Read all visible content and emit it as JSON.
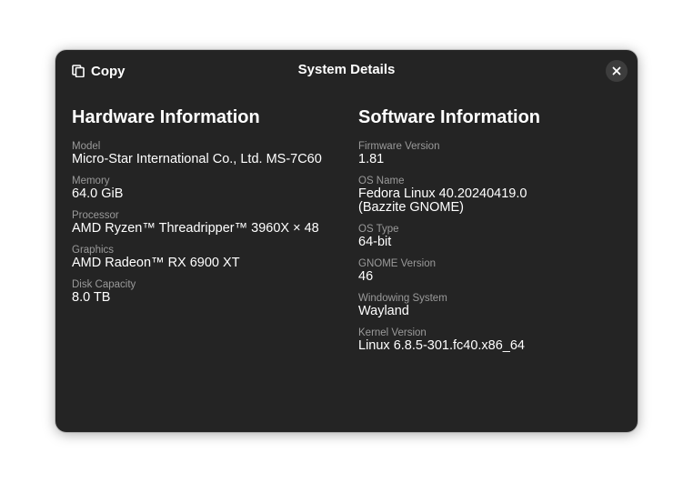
{
  "header": {
    "copy_label": "Copy",
    "title": "System Details",
    "copy_icon": "copy-icon",
    "close_icon": "close-icon"
  },
  "hardware": {
    "title": "Hardware Information",
    "fields": [
      {
        "label": "Model",
        "value": "Micro-Star International Co., Ltd. MS-7C60"
      },
      {
        "label": "Memory",
        "value": "64.0 GiB"
      },
      {
        "label": "Processor",
        "value": "AMD Ryzen™ Threadripper™ 3960X × 48"
      },
      {
        "label": "Graphics",
        "value": "AMD Radeon™ RX 6900 XT"
      },
      {
        "label": "Disk Capacity",
        "value": "8.0 TB"
      }
    ]
  },
  "software": {
    "title": "Software Information",
    "fields": [
      {
        "label": "Firmware Version",
        "value": "1.81"
      },
      {
        "label": "OS Name",
        "value": "Fedora Linux 40.20240419.0\n(Bazzite GNOME)"
      },
      {
        "label": "OS Type",
        "value": "64-bit"
      },
      {
        "label": "GNOME Version",
        "value": "46"
      },
      {
        "label": "Windowing System",
        "value": "Wayland"
      },
      {
        "label": "Kernel Version",
        "value": "Linux 6.8.5-301.fc40.x86_64"
      }
    ]
  },
  "colors": {
    "dialog_bg": "#242424",
    "label": "#9a9a9a",
    "text": "#ffffff",
    "close_bg": "#3d3d3d"
  }
}
